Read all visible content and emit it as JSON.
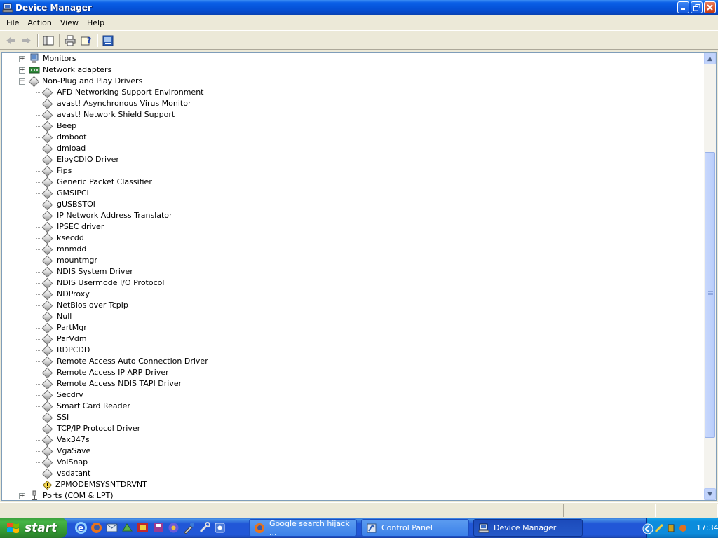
{
  "window": {
    "title": "Device Manager",
    "minimize_icon": "minimize-icon",
    "maximize_icon": "restore-icon",
    "close_icon": "close-icon"
  },
  "menu": [
    "File",
    "Action",
    "View",
    "Help"
  ],
  "toolbar": {
    "buttons": [
      "back-icon",
      "forward-icon",
      "show-hide-tree-icon",
      "print-icon",
      "help-icon",
      "properties-icon"
    ]
  },
  "tree": {
    "categories": {
      "monitors": "Monitors",
      "network_adapters": "Network adapters",
      "non_pnp": "Non-Plug and Play Drivers",
      "ports": "Ports (COM & LPT)"
    },
    "drivers": [
      "AFD Networking Support Environment",
      "avast! Asynchronous Virus Monitor",
      "avast! Network Shield Support",
      "Beep",
      "dmboot",
      "dmload",
      "ElbyCDIO Driver",
      "Fips",
      "Generic Packet Classifier",
      "GMSIPCI",
      "gUSBSTOi",
      "IP Network Address Translator",
      "IPSEC driver",
      "ksecdd",
      "mnmdd",
      "mountmgr",
      "NDIS System Driver",
      "NDIS Usermode I/O Protocol",
      "NDProxy",
      "NetBios over Tcpip",
      "Null",
      "PartMgr",
      "ParVdm",
      "RDPCDD",
      "Remote Access Auto Connection Driver",
      "Remote Access IP ARP Driver",
      "Remote Access NDIS TAPI Driver",
      "Secdrv",
      "Smart Card Reader",
      "SSI",
      "TCP/IP Protocol Driver",
      "Vax347s",
      "VgaSave",
      "VolSnap",
      "vsdatant"
    ],
    "warning_driver": "ZPMODEMSYSNTDRVNT"
  },
  "taskbar": {
    "start_label": "start",
    "tasks": [
      {
        "label": "Google search hijack ...",
        "icon": "firefox-icon",
        "active": false
      },
      {
        "label": "Control Panel",
        "icon": "control-panel-icon",
        "active": false
      },
      {
        "label": "Device Manager",
        "icon": "device-manager-icon",
        "active": true
      }
    ],
    "clock": "17:34"
  },
  "colors": {
    "titlebar": "#0552d8",
    "taskbar": "#2157d7",
    "start_button": "#3c9e3c",
    "tray": "#0c8ddd"
  }
}
